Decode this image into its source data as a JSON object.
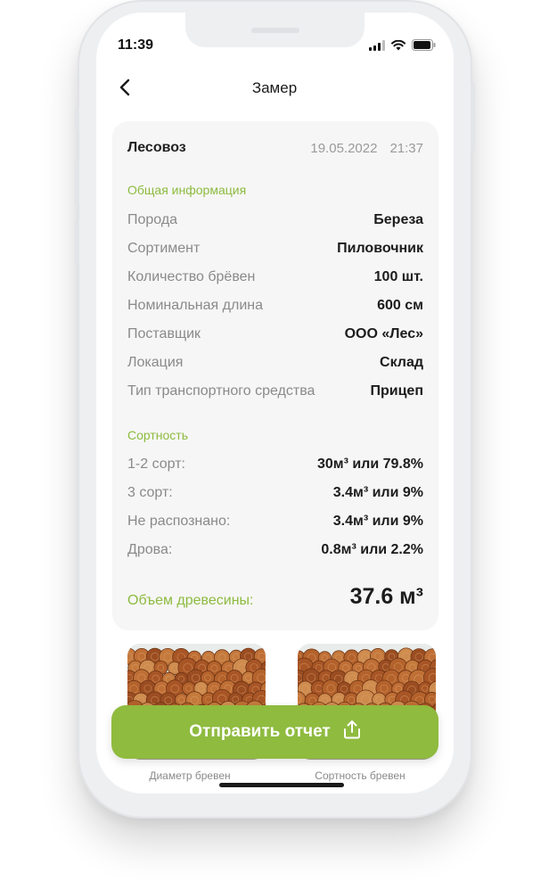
{
  "status_bar": {
    "time": "11:39"
  },
  "header": {
    "title": "Замер"
  },
  "record": {
    "title": "Лесовоз",
    "date": "19.05.2022",
    "time": "21:37"
  },
  "general": {
    "heading": "Общая информация",
    "rows": [
      {
        "label": "Порода",
        "value": "Береза"
      },
      {
        "label": "Сортимент",
        "value": "Пиловочник"
      },
      {
        "label": "Количество брёвен",
        "value": "100 шт."
      },
      {
        "label": "Номинальная длина",
        "value": "600 см"
      },
      {
        "label": "Поставщик",
        "value": "ООО «Лес»"
      },
      {
        "label": "Локация",
        "value": "Склад"
      },
      {
        "label": "Тип транспортного средства",
        "value": "Прицеп"
      }
    ]
  },
  "grades": {
    "heading": "Сортность",
    "rows": [
      {
        "label": "1-2 сорт:",
        "value": "30м³ или 79.8%"
      },
      {
        "label": "3 сорт:",
        "value": "3.4м³ или 9%"
      },
      {
        "label": "Не распознано:",
        "value": "3.4м³ или 9%"
      },
      {
        "label": "Дрова:",
        "value": "0.8м³ или 2.2%"
      }
    ]
  },
  "volume": {
    "label": "Объем древесины:",
    "value": "37.6 м³"
  },
  "photos": [
    {
      "caption": "Диаметр бревен"
    },
    {
      "caption": "Сортность бревен"
    }
  ],
  "send_button": {
    "label": "Отправить отчет"
  },
  "colors": {
    "accent": "#8fbb3f",
    "card_bg": "#f6f6f6",
    "label_gray": "#8a8a8a"
  },
  "icons": [
    "back-arrow-icon",
    "signal-icon",
    "wifi-icon",
    "battery-icon",
    "share-icon"
  ]
}
